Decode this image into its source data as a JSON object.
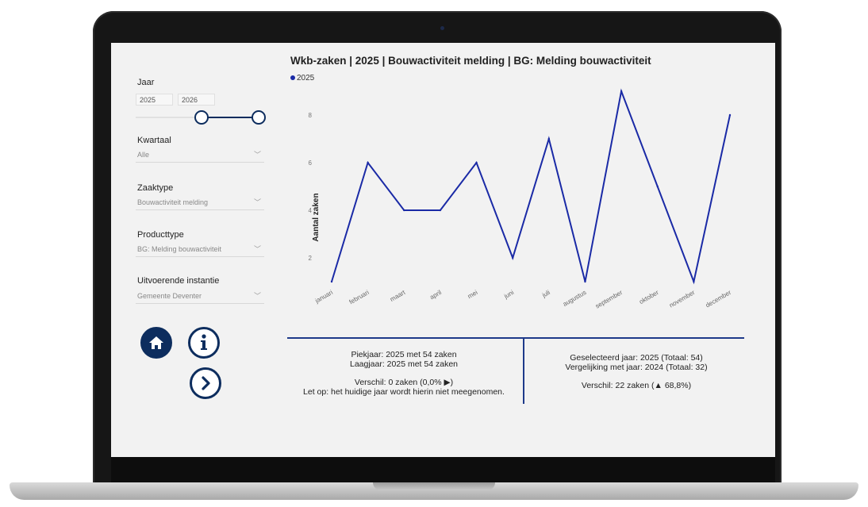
{
  "filters": {
    "jaar_label": "Jaar",
    "year_from": "2025",
    "year_to": "2026",
    "kwartaal_label": "Kwartaal",
    "kwartaal_value": "Alle",
    "zaaktype_label": "Zaaktype",
    "zaaktype_value": "Bouwactiviteit melding",
    "producttype_label": "Producttype",
    "producttype_value": "BG: Melding bouwactiviteit",
    "instantie_label": "Uitvoerende instantie",
    "instantie_value": "Gemeente Deventer"
  },
  "chart_data": {
    "type": "line",
    "title": "Wkb-zaken | 2025 | Bouwactiviteit melding | BG: Melding bouwactiviteit",
    "ylabel": "Aantal zaken",
    "xlabel": "",
    "categories": [
      "januari",
      "februari",
      "maart",
      "april",
      "mei",
      "juni",
      "juli",
      "augustus",
      "september",
      "oktober",
      "november",
      "december"
    ],
    "series": [
      {
        "name": "2025",
        "color": "#1a2aa6",
        "values": [
          1,
          6,
          4,
          4,
          6,
          2,
          7,
          1,
          9,
          5,
          1,
          8
        ]
      }
    ],
    "yticks": [
      2,
      4,
      6,
      8
    ],
    "ylim": [
      1,
      9
    ],
    "grid": false,
    "legend": "top-left"
  },
  "stats": {
    "piekjaar": "Piekjaar: 2025 met 54 zaken",
    "laagjaar": "Laagjaar: 2025 met 54 zaken",
    "verschil_left": "Verschil: 0 zaken (0,0% ▶)",
    "let_op": "Let op: het huidige jaar wordt hierin niet meegenomen.",
    "geselecteerd": "Geselecteerd jaar: 2025 (Totaal: 54)",
    "vergelijking": "Vergelijking met jaar: 2024 (Totaal: 32)",
    "verschil_right": "Verschil: 22 zaken (▲ 68,8%)"
  },
  "colors": {
    "accent": "#1a2aa6",
    "nav": "#0d2d5e",
    "divider": "#1e3a8a"
  },
  "icons": {
    "home": "home-icon",
    "info": "info-icon",
    "next": "chevron-right-icon"
  }
}
